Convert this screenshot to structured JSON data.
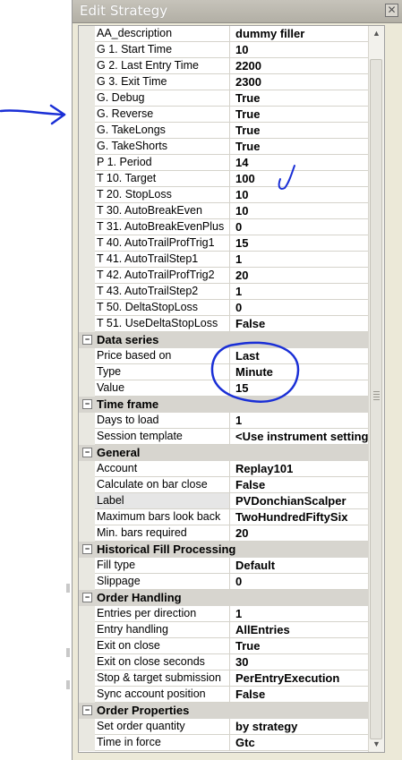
{
  "window": {
    "title": "Edit Strategy",
    "close_icon": "✕"
  },
  "parameters": [
    {
      "name": "AA_description",
      "value": "dummy filler"
    },
    {
      "name": "G 1. Start Time",
      "value": "10"
    },
    {
      "name": "G 2. Last Entry Time",
      "value": "2200"
    },
    {
      "name": "G 3. Exit Time",
      "value": "2300"
    },
    {
      "name": "G. Debug",
      "value": "True"
    },
    {
      "name": "G. Reverse",
      "value": "True"
    },
    {
      "name": "G. TakeLongs",
      "value": "True"
    },
    {
      "name": "G. TakeShorts",
      "value": "True"
    },
    {
      "name": "P 1. Period",
      "value": "14"
    },
    {
      "name": "T 10. Target",
      "value": "100"
    },
    {
      "name": "T 20. StopLoss",
      "value": "10"
    },
    {
      "name": "T 30. AutoBreakEven",
      "value": "10"
    },
    {
      "name": "T 31. AutoBreakEvenPlus",
      "value": "0"
    },
    {
      "name": "T 40. AutoTrailProfTrig1",
      "value": "15"
    },
    {
      "name": "T 41. AutoTrailStep1",
      "value": "1"
    },
    {
      "name": "T 42. AutoTrailProfTrig2",
      "value": "20"
    },
    {
      "name": "T 43. AutoTrailStep2",
      "value": "1"
    },
    {
      "name": "T 50. DeltaStopLoss",
      "value": "0"
    },
    {
      "name": "T 51. UseDeltaStopLoss",
      "value": "False"
    }
  ],
  "data_series": {
    "label": "Data series",
    "toggle": "−",
    "rows": [
      {
        "name": "Price based on",
        "value": "Last"
      },
      {
        "name": "Type",
        "value": "Minute"
      },
      {
        "name": "Value",
        "value": "15"
      }
    ]
  },
  "time_frame": {
    "label": "Time frame",
    "toggle": "−",
    "rows": [
      {
        "name": "Days to load",
        "value": "1"
      },
      {
        "name": "Session template",
        "value": "<Use instrument settings>"
      }
    ]
  },
  "general": {
    "label": "General",
    "toggle": "−",
    "rows": [
      {
        "name": "Account",
        "value": "Replay101"
      },
      {
        "name": "Calculate on bar close",
        "value": "False"
      },
      {
        "name": "Label",
        "value": "PVDonchianScalper"
      },
      {
        "name": "Maximum bars look back",
        "value": "TwoHundredFiftySix"
      },
      {
        "name": "Min. bars required",
        "value": "20"
      }
    ]
  },
  "historical_fill": {
    "label": "Historical Fill Processing",
    "toggle": "−",
    "rows": [
      {
        "name": "Fill type",
        "value": "Default"
      },
      {
        "name": "Slippage",
        "value": "0"
      }
    ]
  },
  "order_handling": {
    "label": "Order Handling",
    "toggle": "−",
    "rows": [
      {
        "name": "Entries per direction",
        "value": "1"
      },
      {
        "name": "Entry handling",
        "value": "AllEntries"
      },
      {
        "name": "Exit on close",
        "value": "True"
      },
      {
        "name": "Exit on close seconds",
        "value": "30"
      },
      {
        "name": "Stop & target submission",
        "value": "PerEntryExecution"
      },
      {
        "name": "Sync account position",
        "value": "False"
      }
    ]
  },
  "order_properties": {
    "label": "Order Properties",
    "toggle": "−",
    "rows": [
      {
        "name": "Set order quantity",
        "value": "by strategy"
      },
      {
        "name": "Time in force",
        "value": "Gtc"
      }
    ]
  },
  "scrollbar": {
    "up_icon": "▲",
    "down_icon": "▼"
  },
  "colors": {
    "annotation_ink": "#1a2fd6",
    "category_bg": "#d7d5cf",
    "titlebar": "#b8b5ac"
  }
}
